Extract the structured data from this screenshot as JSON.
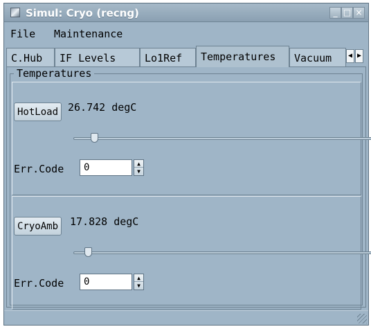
{
  "window": {
    "title": "Simul: Cryo (recng)",
    "buttons": {
      "minimize": "_",
      "maximize": "□",
      "close": "×"
    }
  },
  "menu": {
    "items": [
      "File",
      "Maintenance"
    ]
  },
  "tabs": {
    "items": [
      "C.Hub",
      "IF Levels",
      "Lo1Ref",
      "Temperatures",
      "Vacuum"
    ],
    "active": "Temperatures",
    "scroll_left": "◀",
    "scroll_right": "▶"
  },
  "panel": {
    "group_title": "Temperatures",
    "sections": [
      {
        "button_label": "HotLoad",
        "value_text": "26.742 degC",
        "slider_fraction": 0.07,
        "err_label": "Err.Code",
        "err_value": "0"
      },
      {
        "button_label": "CryoAmb",
        "value_text": "17.828 degC",
        "slider_fraction": 0.05,
        "err_label": "Err.Code",
        "err_value": "0"
      }
    ]
  },
  "icons": {
    "app": "app-icon",
    "spin_up": "▲",
    "spin_down": "▼"
  },
  "colors": {
    "window_bg": "#9fb5c7",
    "title_bar": "#8aa0b2"
  }
}
